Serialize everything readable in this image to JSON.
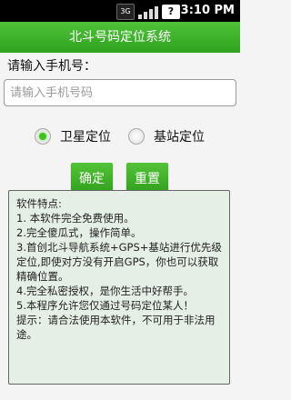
{
  "status_bar": {
    "network_label": "3G",
    "battery_label": "?",
    "time": "3:10 PM"
  },
  "title": "北斗号码定位系统",
  "phone_label": "请输入手机号：",
  "phone_input": {
    "value": "",
    "placeholder": "请输入手机号码"
  },
  "locate_mode": {
    "options": [
      {
        "label": "卫星定位",
        "selected": true
      },
      {
        "label": "基站定位",
        "selected": false
      }
    ]
  },
  "buttons": {
    "confirm": "确定",
    "reset": "重置"
  },
  "features": {
    "heading": "软件特点:",
    "lines": [
      " 1. 本软件完全免费使用。",
      " 2.完全傻瓜式，操作简单。",
      "3.首创北斗导航系统+GPS+基站进行优先级定位,即使对方没有开启GPS，你也可以获取精确位置。",
      " 4.完全私密授权，是你生活中好帮手。",
      " 5.本程序允许您仅通过号码定位某人！",
      " 提示：请合法使用本软件，不可用于非法用途。"
    ]
  }
}
